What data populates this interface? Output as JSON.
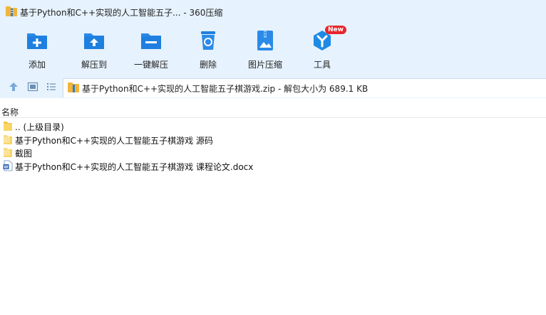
{
  "window": {
    "title": "基于Python和C++实现的人工智能五子... - 360压缩"
  },
  "toolbar": {
    "items": [
      {
        "label": "添加",
        "icon": "add-icon"
      },
      {
        "label": "解压到",
        "icon": "extract-to-icon"
      },
      {
        "label": "一键解压",
        "icon": "one-click-extract-icon"
      },
      {
        "label": "删除",
        "icon": "recycle-delete-icon"
      },
      {
        "label": "图片压缩",
        "icon": "image-compress-icon"
      },
      {
        "label": "工具",
        "icon": "tools-icon",
        "badge": "New"
      }
    ]
  },
  "navbar": {
    "path": "基于Python和C++实现的人工智能五子棋游戏.zip - 解包大小为 689.1 KB"
  },
  "filelist": {
    "column_name": "名称",
    "items": [
      {
        "name": ".. (上级目录)",
        "type": "parent-folder"
      },
      {
        "name": "基于Python和C++实现的人工智能五子棋游戏 源码",
        "type": "folder"
      },
      {
        "name": "截图",
        "type": "folder"
      },
      {
        "name": "基于Python和C++实现的人工智能五子棋游戏 课程论文.docx",
        "type": "docx"
      }
    ]
  },
  "colors": {
    "chrome_bg": "#e6f2fd",
    "accent": "#1e8ae6",
    "badge": "#e8262d"
  }
}
